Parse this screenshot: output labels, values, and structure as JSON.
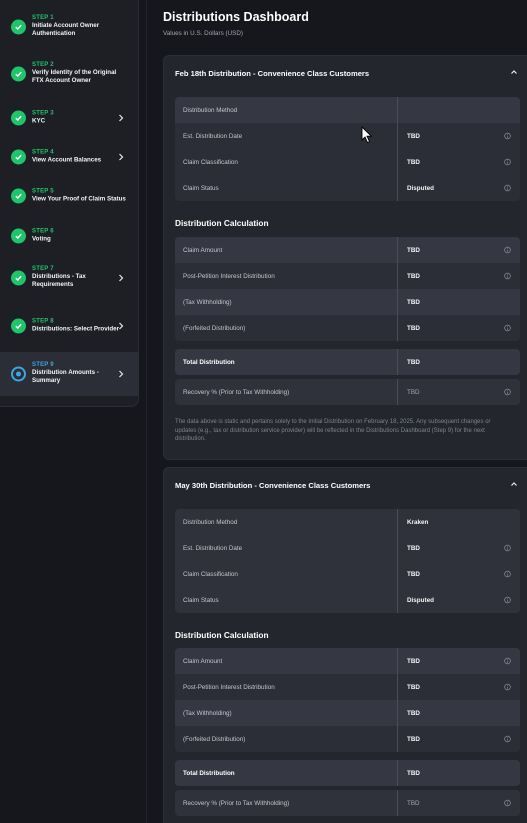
{
  "sidebar": {
    "steps": [
      {
        "num": "STEP 1",
        "title": "Initiate Account Owner Authentication",
        "state": "done",
        "chevron": false
      },
      {
        "num": "STEP 2",
        "title": "Verify Identity of the Original FTX Account Owner",
        "state": "done",
        "chevron": false
      },
      {
        "num": "STEP 3",
        "title": "KYC",
        "state": "done",
        "chevron": true
      },
      {
        "num": "STEP 4",
        "title": "View Account Balances",
        "state": "done",
        "chevron": true
      },
      {
        "num": "STEP 5",
        "title": "View Your Proof of Claim Status",
        "state": "done",
        "chevron": false
      },
      {
        "num": "STEP 6",
        "title": "Voting",
        "state": "done",
        "chevron": false
      },
      {
        "num": "STEP 7",
        "title": "Distributions - Tax Requirements",
        "state": "done",
        "chevron": true
      },
      {
        "num": "STEP 8",
        "title": "Distributions: Select Provider",
        "state": "done",
        "chevron": true
      },
      {
        "num": "STEP 9",
        "title": "Distribution Amounts - Summary",
        "state": "current",
        "chevron": true
      }
    ]
  },
  "header": {
    "title": "Distributions Dashboard",
    "subtitle": "Values in U.S. Dollars (USD)"
  },
  "cards": [
    {
      "title": "Feb 18th Distribution - Convenience Class Customers",
      "details": [
        {
          "label": "Distribution Method",
          "value": "",
          "info": false
        },
        {
          "label": "Est. Distribution Date",
          "value": "TBD",
          "info": true
        },
        {
          "label": "Claim Classification",
          "value": "TBD",
          "info": true
        },
        {
          "label": "Claim Status",
          "value": "Disputed",
          "info": true
        }
      ],
      "calc_title": "Distribution Calculation",
      "calc": [
        {
          "label": "Claim Amount",
          "value": "TBD",
          "info": true
        },
        {
          "label": "Post-Petition Interest Distribution",
          "value": "TBD",
          "info": true
        },
        {
          "label": "(Tax Withholding)",
          "value": "TBD",
          "info": false
        },
        {
          "label": "(Forfeited Distribution)",
          "value": "TBD",
          "info": true
        }
      ],
      "total": {
        "label": "Total Distribution",
        "value": "TBD"
      },
      "recovery": {
        "label": "Recovery % (Prior to Tax Withholding)",
        "value": "TBD"
      },
      "note": "The data above is static and pertains solely to the Initial Distribution on February 18, 2025. Any subsequent changes or updates (e.g., tax or distribution service provider) will be reflected in the Distributions Dashboard (Step 9) for the next distribution."
    },
    {
      "title": "May 30th Distribution - Convenience Class Customers",
      "details": [
        {
          "label": "Distribution Method",
          "value": "Kraken",
          "info": false
        },
        {
          "label": "Est. Distribution Date",
          "value": "TBD",
          "info": true
        },
        {
          "label": "Claim Classification",
          "value": "TBD",
          "info": true
        },
        {
          "label": "Claim Status",
          "value": "Disputed",
          "info": true
        }
      ],
      "calc_title": "Distribution Calculation",
      "calc": [
        {
          "label": "Claim Amount",
          "value": "TBD",
          "info": true
        },
        {
          "label": "Post-Petition Interest Distribution",
          "value": "TBD",
          "info": true
        },
        {
          "label": "(Tax Withholding)",
          "value": "TBD",
          "info": false
        },
        {
          "label": "(Forfeited Distribution)",
          "value": "TBD",
          "info": true
        }
      ],
      "total": {
        "label": "Total Distribution",
        "value": "TBD"
      },
      "recovery": {
        "label": "Recovery % (Prior to Tax Withholding)",
        "value": "TBD"
      }
    }
  ],
  "colors": {
    "accent_green": "#1fc46b",
    "accent_blue": "#3ba7e0",
    "background": "#15171c"
  }
}
